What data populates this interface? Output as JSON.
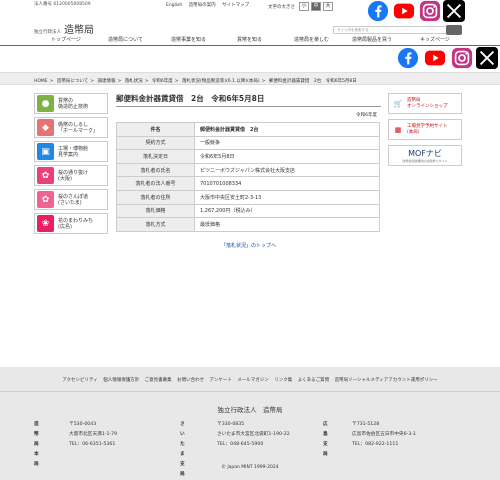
{
  "header": {
    "corporate_number": "法人番号 6120005008509",
    "top_links": [
      "English",
      "造幣局の案内",
      "サイトマップ"
    ],
    "font_size_label": "文字の大きさ",
    "font_sizes": [
      "小",
      "中",
      "大"
    ],
    "logo_small": "独立行政法人",
    "logo_main": "造幣局",
    "search_placeholder": "サイト内を検索する"
  },
  "nav": [
    "トップページ",
    "造幣局について",
    "造幣事業を知る",
    "貨幣を知る",
    "造幣局を楽しむ",
    "造幣局製品を買う",
    "キッズページ"
  ],
  "breadcrumb": [
    "HOME",
    "造幣局について",
    "調達情報",
    "落札状況",
    "令和6年度",
    "落札状況(物品製造等)(6.1.以降)(本局)",
    "郵便料金計器賃貸借　2台　令和6年5月8日"
  ],
  "sidebar": [
    {
      "label": "貨幣の\n偽造防止技術",
      "color": "#7cb342",
      "icon": "coin-icon"
    },
    {
      "label": "偽幣のしるし\n「ホールマーク」",
      "color": "#e57373",
      "icon": "hallmark-icon"
    },
    {
      "label": "工場・博物館\n見学案内",
      "color": "#1e88e5",
      "icon": "factory-icon"
    },
    {
      "label": "桜の通り抜け\n(大阪)",
      "color": "#ec407a",
      "icon": "sakura-icon"
    },
    {
      "label": "桜のさんぽ道\n(さいたま)",
      "color": "#f06292",
      "icon": "sakura-icon"
    },
    {
      "label": "花のまわりみち\n(広島)",
      "color": "#e91e63",
      "icon": "flower-icon"
    }
  ],
  "main": {
    "title": "郵便料金計器賃貸借　2台　令和6年5月8日",
    "fiscal_year": "令和6年度",
    "table": [
      {
        "k": "件名",
        "v": "郵便料金計器賃貸借　2台"
      },
      {
        "k": "契約方式",
        "v": "一般競争"
      },
      {
        "k": "落札決定日",
        "v": "令和6年5月8日"
      },
      {
        "k": "落札者の氏名",
        "v": "ピツニーボウズジャパン株式会社大阪支店"
      },
      {
        "k": "落札者の法人番号",
        "v": "7010701008334"
      },
      {
        "k": "落札者の住所",
        "v": "大阪市中央区安土町2-3-13"
      },
      {
        "k": "落札価格",
        "v": "1,267,200円（税込み）"
      },
      {
        "k": "落札方式",
        "v": "最低価格"
      }
    ],
    "back_link": "「落札状況」のトップへ"
  },
  "right_banners": [
    {
      "label": "造幣局\nオンラインショップ",
      "icon": "cart-icon"
    },
    {
      "label": "工場見学予約サイト\n(本局)",
      "icon": "building-icon"
    }
  ],
  "mof": {
    "title": "MOFナビ",
    "sub": "財務省関連機関の採用求人サイト"
  },
  "footer": {
    "links": [
      "アクセシビリティ",
      "個人情報保護方針",
      "ご意見書募集",
      "お問い合わせ",
      "アンケート",
      "メールマガジン",
      "リンク集",
      "よくあるご質問",
      "造幣局ソーシャルメディアアカウント運用ポリシー"
    ],
    "org": "独立行政法人　造幣局",
    "offices": [
      {
        "name": "造幣局本局",
        "lines": [
          "〒530-0043",
          "大阪市北区天満1-1-79",
          "TEL：06-6351-5361"
        ]
      },
      {
        "name": "さいたま支局",
        "lines": [
          "〒330-0835",
          "さいたま市大宮区北袋町1-190-22",
          "TEL：048-645-5900"
        ]
      },
      {
        "name": "広島支局",
        "lines": [
          "〒731-5128",
          "広島市佐伯区五日市中央6-3-1",
          "TEL：082-922-1111"
        ]
      }
    ],
    "copyright": "© Japan MINT 1999-2024"
  }
}
